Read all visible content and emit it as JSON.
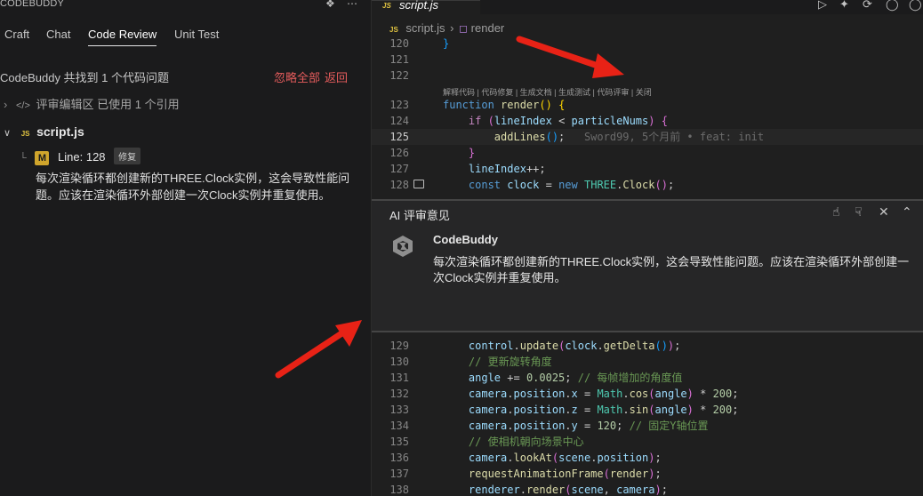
{
  "left_panel": {
    "title": "CODEBUDDY",
    "icons": {
      "plugin": "plugin-icon",
      "more": "more-icon"
    },
    "tabs": [
      {
        "label": "Craft"
      },
      {
        "label": "Chat"
      },
      {
        "label": "Code Review",
        "active": true
      },
      {
        "label": "Unit Test"
      }
    ],
    "summary": "CodeBuddy 共找到 1 个代码问题",
    "ignore_all": "忽略全部",
    "back": "返回",
    "reference_row": "评审编辑区 已使用 1 个引用",
    "file": {
      "badge": "JS",
      "name": "script.js"
    },
    "issue": {
      "severity_badge": "M",
      "line_label": "Line: 128",
      "fix_label": "修复",
      "description": "每次渲染循环都创建新的THREE.Clock实例，这会导致性能问题。应该在渲染循环外部创建一次Clock实例并重复使用。"
    }
  },
  "editor": {
    "tab": {
      "badge": "JS",
      "name": "script.js"
    },
    "breadcrumb": {
      "file": "script.js",
      "symbol": "render"
    },
    "codelens": "解释代码 | 代码修复 | 生成文档 | 生成测试 | 代码评审 | 关闭",
    "blame": "Sword99, 5个月前 • feat: init",
    "line_numbers_top": [
      "120",
      "121",
      "122",
      "123",
      "124",
      "125",
      "126",
      "127",
      "128"
    ],
    "line_numbers_bottom": [
      "129",
      "130",
      "131",
      "132",
      "133",
      "134",
      "135",
      "136",
      "137",
      "138"
    ],
    "review": {
      "title": "AI 评审意见",
      "bot_name": "CodeBuddy",
      "message": "每次渲染循环都创建新的THREE.Clock实例，这会导致性能问题。应该在渲染循环外部创建一次Clock实例并重复使用。"
    }
  },
  "colors": {
    "accent_red": "#e35b5b",
    "arrow_red": "#e82216",
    "badge_yellow": "#d0a52c"
  }
}
